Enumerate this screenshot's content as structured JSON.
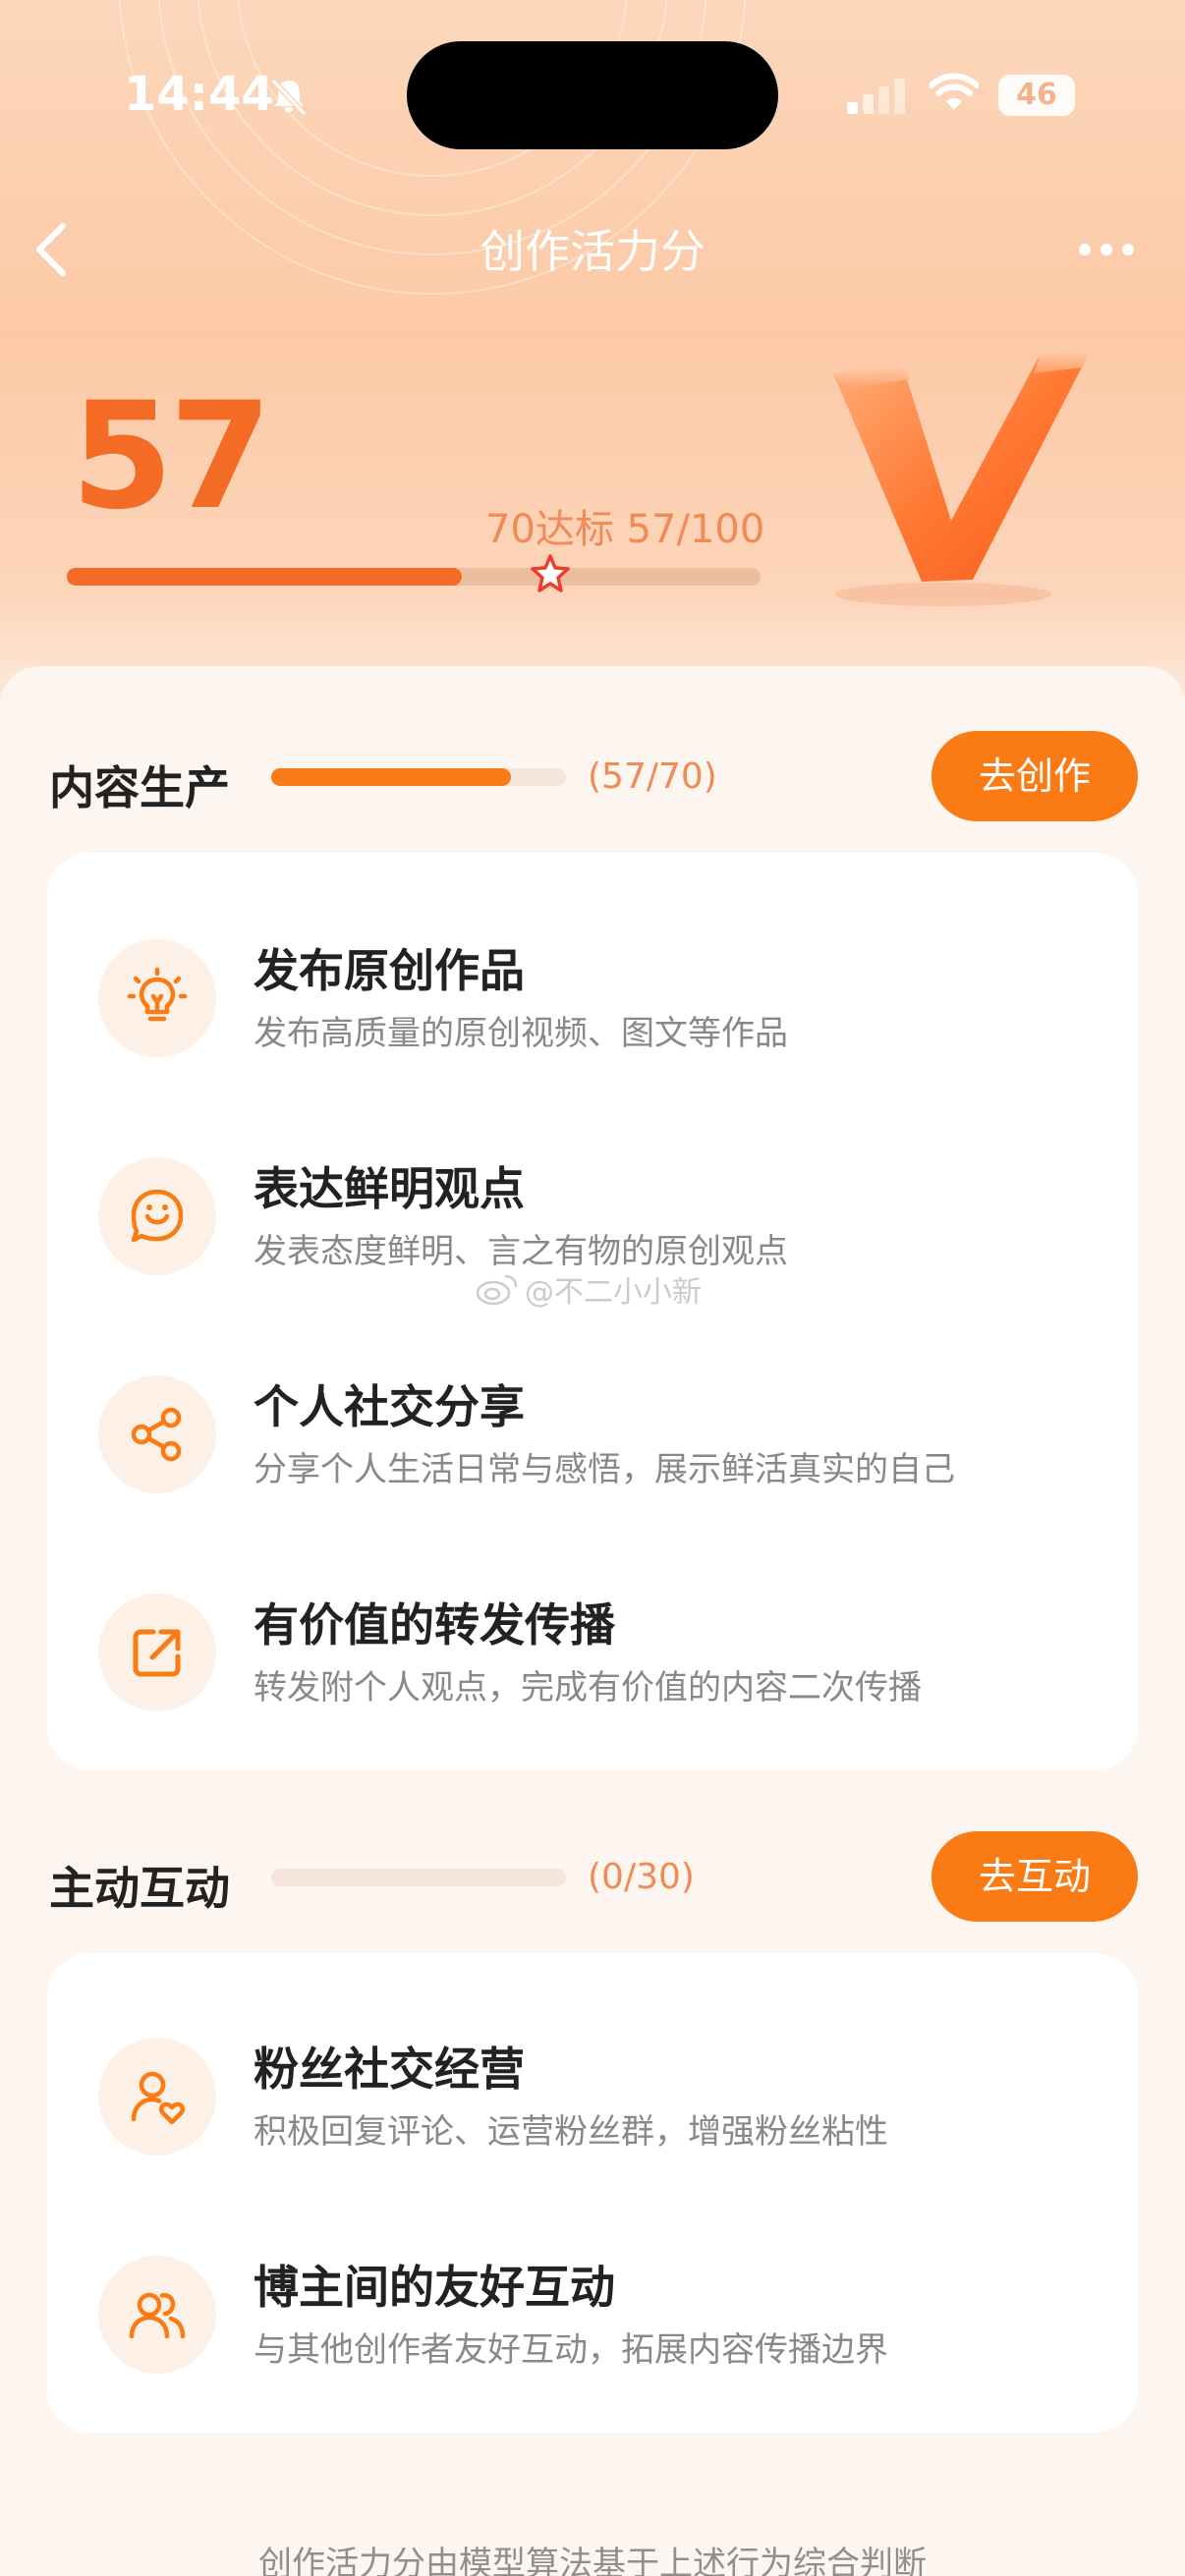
{
  "status_bar": {
    "time": "14:44",
    "battery": "46"
  },
  "nav": {
    "title": "创作活力分"
  },
  "score": {
    "value": "57",
    "target_text": "70达标 57/100",
    "progress_fraction": 0.57,
    "target_fraction": 0.7
  },
  "sections": {
    "content": {
      "title": "内容生产",
      "count": "(57/70)",
      "progress_fraction": 0.814,
      "button": "去创作",
      "items": [
        {
          "title": "发布原创作品",
          "desc": "发布高质量的原创视频、图文等作品",
          "icon": "lightbulb-icon"
        },
        {
          "title": "表达鲜明观点",
          "desc": "发表态度鲜明、言之有物的原创观点",
          "icon": "smile-bubble-icon"
        },
        {
          "title": "个人社交分享",
          "desc": "分享个人生活日常与感悟，展示鲜活真实的自己",
          "icon": "share-icon"
        },
        {
          "title": "有价值的转发传播",
          "desc": "转发附个人观点，完成有价值的内容二次传播",
          "icon": "forward-icon"
        }
      ]
    },
    "interact": {
      "title": "主动互动",
      "count": "(0/30)",
      "progress_fraction": 0,
      "button": "去互动",
      "items": [
        {
          "title": "粉丝社交经营",
          "desc": "积极回复评论、运营粉丝群，增强粉丝粘性",
          "icon": "user-heart-icon"
        },
        {
          "title": "博主间的友好互动",
          "desc": "与其他创作者友好互动，拓展内容传播边界",
          "icon": "users-icon"
        }
      ]
    }
  },
  "watermark": "@不二小小新",
  "footer": "创作活力分由模型算法基于上述行为综合判断",
  "colors": {
    "accent": "#fa7b14",
    "score": "#f36b25",
    "muted": "#f08a56"
  }
}
